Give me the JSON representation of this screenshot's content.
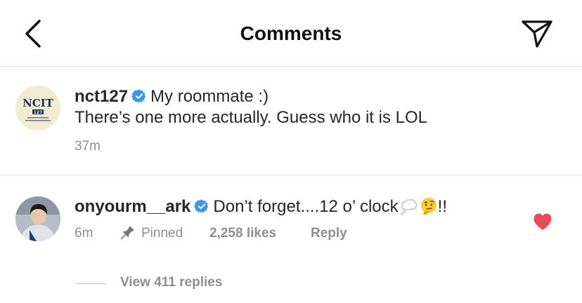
{
  "header": {
    "title": "Comments",
    "back_icon": "chevron-left-icon",
    "share_icon": "paper-plane-icon"
  },
  "caption": {
    "username": "nct127",
    "text_line1": "My roommate :)",
    "text_line2": "There’s one more actually. Guess who it is LOL",
    "time": "37m",
    "avatar_logo_text": "NCIT",
    "avatar_badge_text": "127",
    "verified_icon": "verified-badge-icon"
  },
  "comment": {
    "username": "onyourm__ark",
    "text": "Don’t forget....12 o’ clock",
    "text_suffix": "!!",
    "time": "6m",
    "pinned_label": "Pinned",
    "likes": "2,258 likes",
    "reply_label": "Reply",
    "liked": true,
    "emoji": [
      "thought-balloon-emoji",
      "thinking-face-emoji"
    ]
  },
  "replies": {
    "label": "View 411 replies"
  },
  "colors": {
    "verified": "#3897f0",
    "heart": "#ed4956",
    "muted": "#8e8e8e",
    "divider": "#dbdbdb"
  }
}
